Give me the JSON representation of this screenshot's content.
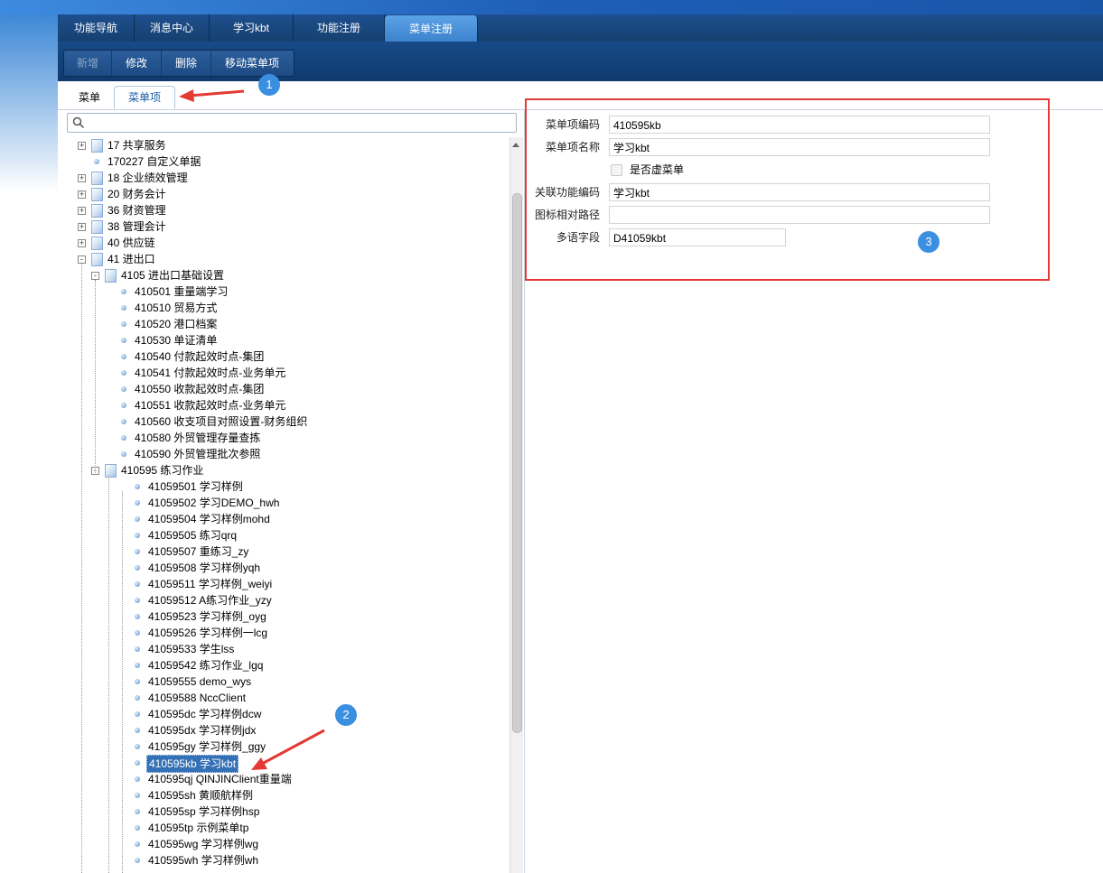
{
  "top_nav": [
    "功能导航",
    "消息中心",
    "学习kbt",
    "功能注册",
    "菜单注册"
  ],
  "toolbar": {
    "new": "新增",
    "edit": "修改",
    "delete": "删除",
    "move": "移动菜单项"
  },
  "sub_tabs": [
    "菜单",
    "菜单项"
  ],
  "search": {
    "placeholder": "",
    "icon": "search-icon"
  },
  "tree": [
    {
      "text": "17 共享服务",
      "level": 0,
      "type": "folder",
      "expander": "+"
    },
    {
      "text": "170227 自定义单据",
      "level": 0,
      "type": "leaf"
    },
    {
      "text": "18 企业绩效管理",
      "level": 0,
      "type": "folder",
      "expander": "+"
    },
    {
      "text": "20 财务会计",
      "level": 0,
      "type": "folder",
      "expander": "+"
    },
    {
      "text": "36 财资管理",
      "level": 0,
      "type": "folder",
      "expander": "+"
    },
    {
      "text": "38 管理会计",
      "level": 0,
      "type": "folder",
      "expander": "+"
    },
    {
      "text": "40 供应链",
      "level": 0,
      "type": "folder",
      "expander": "+"
    },
    {
      "text": "41 进出口",
      "level": 0,
      "type": "folder",
      "expander": "-"
    },
    {
      "text": "4105 进出口基础设置",
      "level": 1,
      "type": "folder",
      "expander": "-"
    },
    {
      "text": "410501 重量端学习",
      "level": 2,
      "type": "leaf"
    },
    {
      "text": "410510 贸易方式",
      "level": 2,
      "type": "leaf"
    },
    {
      "text": "410520 港口档案",
      "level": 2,
      "type": "leaf"
    },
    {
      "text": "410530 单证清单",
      "level": 2,
      "type": "leaf"
    },
    {
      "text": "410540 付款起效时点-集团",
      "level": 2,
      "type": "leaf"
    },
    {
      "text": "410541 付款起效时点-业务单元",
      "level": 2,
      "type": "leaf"
    },
    {
      "text": "410550 收款起效时点-集团",
      "level": 2,
      "type": "leaf"
    },
    {
      "text": "410551 收款起效时点-业务单元",
      "level": 2,
      "type": "leaf"
    },
    {
      "text": "410560 收支项目对照设置-财务组织",
      "level": 2,
      "type": "leaf"
    },
    {
      "text": "410580 外贸管理存量查拣",
      "level": 2,
      "type": "leaf"
    },
    {
      "text": "410590 外贸管理批次参照",
      "level": 2,
      "type": "leaf"
    },
    {
      "text": "410595 练习作业",
      "level": 1,
      "type": "folder",
      "expander": "-"
    },
    {
      "text": "41059501 学习样例",
      "level": 3,
      "type": "leaf"
    },
    {
      "text": "41059502 学习DEMO_hwh",
      "level": 3,
      "type": "leaf"
    },
    {
      "text": "41059504 学习样例mohd",
      "level": 3,
      "type": "leaf"
    },
    {
      "text": "41059505 练习qrq",
      "level": 3,
      "type": "leaf"
    },
    {
      "text": "41059507 重练习_zy",
      "level": 3,
      "type": "leaf"
    },
    {
      "text": "41059508 学习样例yqh",
      "level": 3,
      "type": "leaf"
    },
    {
      "text": "41059511 学习样例_weiyi",
      "level": 3,
      "type": "leaf"
    },
    {
      "text": "41059512 A练习作业_yzy",
      "level": 3,
      "type": "leaf"
    },
    {
      "text": "41059523 学习样例_oyg",
      "level": 3,
      "type": "leaf"
    },
    {
      "text": "41059526 学习样例一lcg",
      "level": 3,
      "type": "leaf"
    },
    {
      "text": "41059533 学生lss",
      "level": 3,
      "type": "leaf"
    },
    {
      "text": "41059542 练习作业_lgq",
      "level": 3,
      "type": "leaf"
    },
    {
      "text": "41059555 demo_wys",
      "level": 3,
      "type": "leaf"
    },
    {
      "text": "41059588 NccClient",
      "level": 3,
      "type": "leaf"
    },
    {
      "text": "410595dc 学习样例dcw",
      "level": 3,
      "type": "leaf"
    },
    {
      "text": "410595dx 学习样例jdx",
      "level": 3,
      "type": "leaf"
    },
    {
      "text": "410595gy 学习样例_ggy",
      "level": 3,
      "type": "leaf"
    },
    {
      "text": "410595kb 学习kbt",
      "level": 3,
      "type": "leaf",
      "selected": true
    },
    {
      "text": "410595qj QINJINClient重量端",
      "level": 3,
      "type": "leaf"
    },
    {
      "text": "410595sh 黄顺航样例",
      "level": 3,
      "type": "leaf"
    },
    {
      "text": "410595sp 学习样例hsp",
      "level": 3,
      "type": "leaf"
    },
    {
      "text": "410595tp 示例菜单tp",
      "level": 3,
      "type": "leaf"
    },
    {
      "text": "410595wg 学习样例wg",
      "level": 3,
      "type": "leaf"
    },
    {
      "text": "410595wh 学习样例wh",
      "level": 3,
      "type": "leaf"
    }
  ],
  "form": {
    "code_label": "菜单项编码",
    "code_value": "410595kb",
    "name_label": "菜单项名称",
    "name_value": "学习kbt",
    "virtual_label": "是否虚菜单",
    "func_label": "关联功能编码",
    "func_value": "学习kbt",
    "icon_label": "图标相对路径",
    "icon_value": "",
    "lang_label": "多语字段",
    "lang_value": "D41059kbt"
  },
  "badges": [
    "1",
    "2",
    "3"
  ],
  "colors": {
    "highlight": "#e53935",
    "badge": "#3b8fe0",
    "selected": "#3470b5"
  }
}
